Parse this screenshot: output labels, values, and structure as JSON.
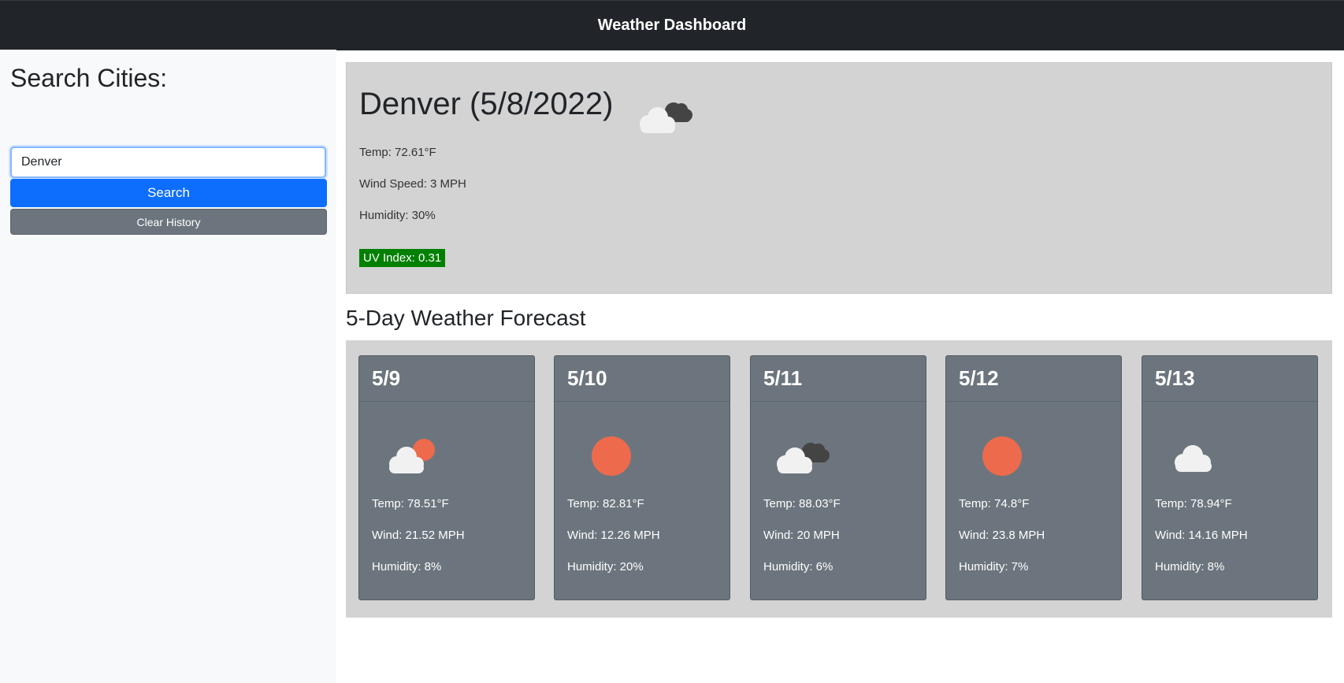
{
  "header": {
    "title": "Weather Dashboard"
  },
  "sidebar": {
    "heading": "Search Cities:",
    "search_value": "Denver",
    "search_button": "Search",
    "clear_button": "Clear History"
  },
  "current": {
    "heading": "Denver (5/8/2022)",
    "icon": "clouds-icon",
    "temp": "Temp: 72.61°F",
    "wind": "Wind Speed: 3 MPH",
    "humidity": "Humidity: 30%",
    "uv": "UV Index: 0.31",
    "uv_color": "#008000"
  },
  "forecast": {
    "title": "5-Day Weather Forecast",
    "days": [
      {
        "date": "5/9",
        "icon": "partly-cloudy-icon",
        "temp": "Temp: 78.51°F",
        "wind": "Wind: 21.52 MPH",
        "humidity": "Humidity: 8%"
      },
      {
        "date": "5/10",
        "icon": "sun-icon",
        "temp": "Temp: 82.81°F",
        "wind": "Wind: 12.26 MPH",
        "humidity": "Humidity: 20%"
      },
      {
        "date": "5/11",
        "icon": "clouds-icon",
        "temp": "Temp: 88.03°F",
        "wind": "Wind: 20 MPH",
        "humidity": "Humidity: 6%"
      },
      {
        "date": "5/12",
        "icon": "sun-icon",
        "temp": "Temp: 74.8°F",
        "wind": "Wind: 23.8 MPH",
        "humidity": "Humidity: 7%"
      },
      {
        "date": "5/13",
        "icon": "cloud-icon",
        "temp": "Temp: 78.94°F",
        "wind": "Wind: 14.16 MPH",
        "humidity": "Humidity: 8%"
      }
    ]
  },
  "colors": {
    "header_bg": "#212529",
    "primary": "#0d6efd",
    "secondary": "#6c757d",
    "panel_bg": "#d3d3d3",
    "sun": "#ee6a4c",
    "cloud_light": "#f1f1f1",
    "cloud_dark": "#444444"
  }
}
